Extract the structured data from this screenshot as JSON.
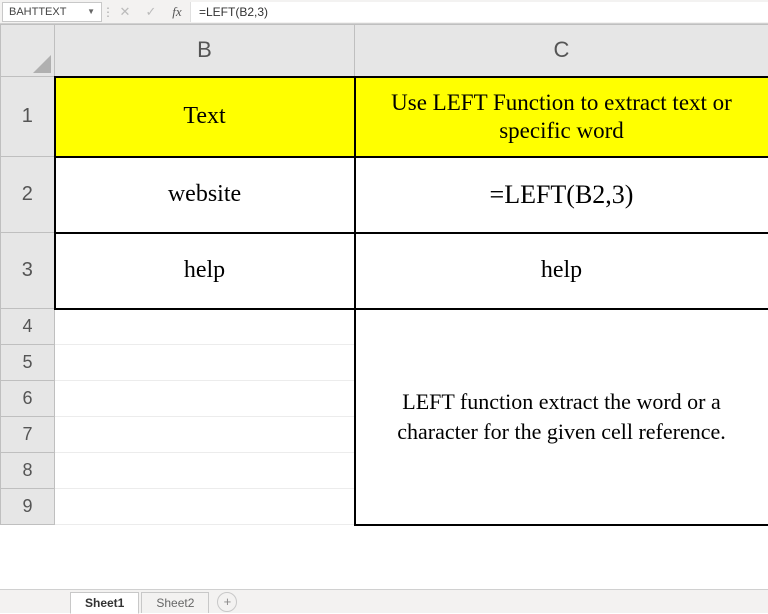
{
  "formulaBar": {
    "nameBox": "BAHTTEXT",
    "formula": "=LEFT(B2,3)"
  },
  "columns": {
    "B": "B",
    "C": "C"
  },
  "rows": {
    "r1": "1",
    "r2": "2",
    "r3": "3",
    "r4": "4",
    "r5": "5",
    "r6": "6",
    "r7": "7",
    "r8": "8",
    "r9": "9"
  },
  "cells": {
    "B1": "Text",
    "C1": "Use LEFT Function to extract text or  specific word",
    "B2": "website",
    "C2": "=LEFT(B2,3)",
    "B3": "help",
    "C3": "help",
    "C_note": "LEFT function extract the word or a character for the given cell reference."
  },
  "tabs": {
    "active": "Sheet1",
    "inactive": "Sheet2"
  },
  "icons": {
    "cancel": "✕",
    "confirm": "✓",
    "fx": "fx",
    "plus": "+",
    "caret": "▼",
    "dots": "⋮"
  }
}
